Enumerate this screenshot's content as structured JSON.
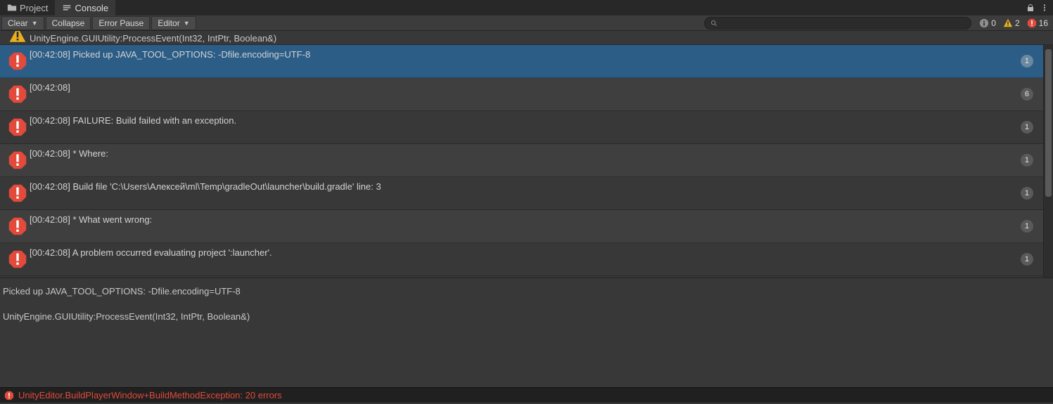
{
  "tabs": {
    "project": "Project",
    "console": "Console"
  },
  "toolbar": {
    "clear": "Clear",
    "collapse": "Collapse",
    "error_pause": "Error Pause",
    "editor": "Editor"
  },
  "filters": {
    "info_count": "0",
    "warn_count": "2",
    "error_count": "16"
  },
  "clipped_row": {
    "text": "UnityEngine.GUIUtility:ProcessEvent(Int32, IntPtr, Boolean&)"
  },
  "logs": [
    {
      "time": "[00:42:08]",
      "text": "Picked up JAVA_TOOL_OPTIONS: -Dfile.encoding=UTF-8",
      "count": "1",
      "selected": true
    },
    {
      "time": "[00:42:08]",
      "text": "",
      "count": "6",
      "selected": false
    },
    {
      "time": "[00:42:08]",
      "text": "FAILURE: Build failed with an exception.",
      "count": "1",
      "selected": false
    },
    {
      "time": "[00:42:08]",
      "text": "* Where:",
      "count": "1",
      "selected": false
    },
    {
      "time": "[00:42:08]",
      "text": "Build file 'C:\\Users\\Алексей\\ml\\Temp\\gradleOut\\launcher\\build.gradle' line: 3",
      "count": "1",
      "selected": false
    },
    {
      "time": "[00:42:08]",
      "text": "* What went wrong:",
      "count": "1",
      "selected": false
    },
    {
      "time": "[00:42:08]",
      "text": "A problem occurred evaluating project ':launcher'.",
      "count": "1",
      "selected": false
    }
  ],
  "detail": {
    "line1": "Picked up JAVA_TOOL_OPTIONS: -Dfile.encoding=UTF-8",
    "line2": "",
    "line3": "UnityEngine.GUIUtility:ProcessEvent(Int32, IntPtr, Boolean&)"
  },
  "status": {
    "text": "UnityEditor.BuildPlayerWindow+BuildMethodException: 20 errors"
  }
}
